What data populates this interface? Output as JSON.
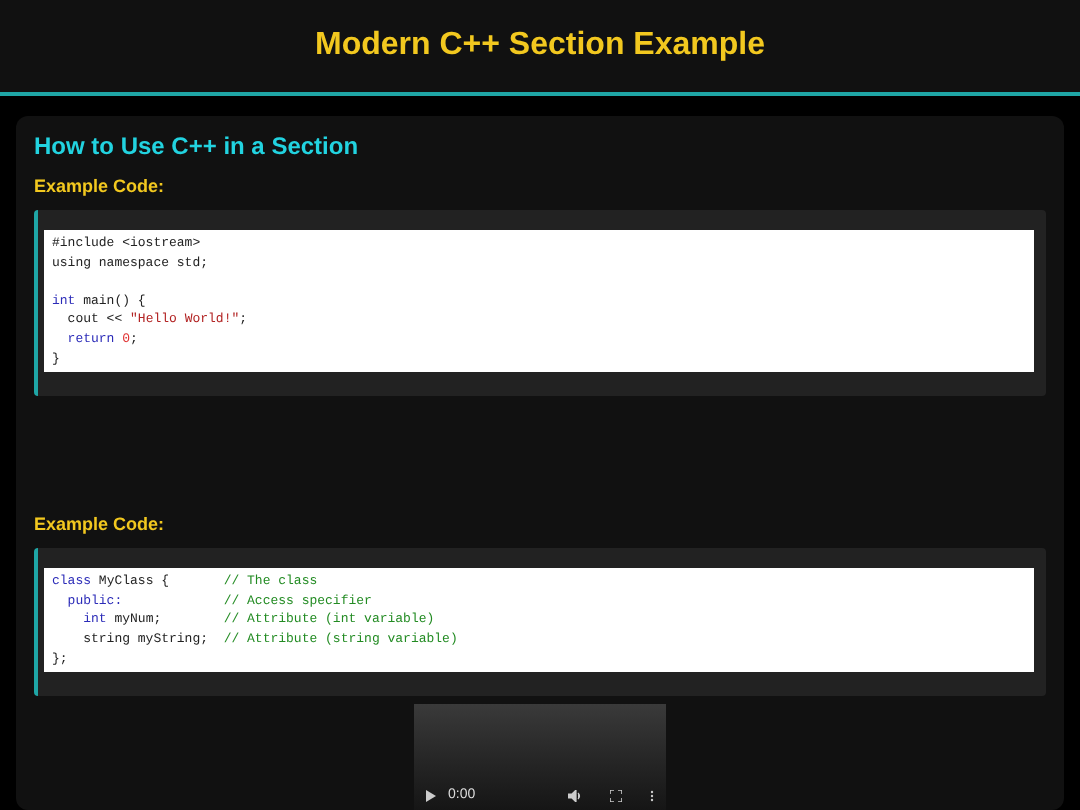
{
  "header": {
    "title": "Modern C++ Section Example"
  },
  "section": {
    "title": "How to Use C++ in a Section",
    "blocks": [
      {
        "label": "Example Code:",
        "lines": [
          {
            "tokens": [
              {
                "kind": "plain",
                "text": "#include <iostream>"
              }
            ]
          },
          {
            "tokens": [
              {
                "kind": "plain",
                "text": "using namespace std;"
              }
            ]
          },
          {
            "blank_before": true,
            "tokens": [
              {
                "kind": "keyword",
                "text": "int"
              },
              {
                "kind": "plain",
                "text": " main() {"
              }
            ]
          },
          {
            "tokens": [
              {
                "kind": "plain",
                "text": "  cout << "
              },
              {
                "kind": "string",
                "text": "\"Hello World!\""
              },
              {
                "kind": "plain",
                "text": ";"
              }
            ]
          },
          {
            "tokens": [
              {
                "kind": "keyword",
                "text": "  return"
              },
              {
                "kind": "number",
                "text": " 0"
              },
              {
                "kind": "plain",
                "text": ";"
              }
            ]
          },
          {
            "tokens": [
              {
                "kind": "plain",
                "text": "}"
              }
            ]
          }
        ]
      },
      {
        "label": "Example Code:",
        "lines": [
          {
            "tokens": [
              {
                "kind": "keyword",
                "text": "class"
              },
              {
                "kind": "plain",
                "text": " MyClass {       "
              },
              {
                "kind": "comment",
                "text": "// The class"
              }
            ]
          },
          {
            "tokens": [
              {
                "kind": "keyword",
                "text": "  public:"
              },
              {
                "kind": "comment",
                "text": "             // Access specifier"
              }
            ]
          },
          {
            "tokens": [
              {
                "kind": "keyword",
                "text": "    int"
              },
              {
                "kind": "plain",
                "text": " myNum;        "
              },
              {
                "kind": "comment",
                "text": "// Attribute (int variable)"
              }
            ]
          },
          {
            "tokens": [
              {
                "kind": "plain",
                "text": "    string myString;  "
              },
              {
                "kind": "comment",
                "text": "// Attribute (string variable)"
              }
            ]
          },
          {
            "tokens": [
              {
                "kind": "plain",
                "text": "};"
              }
            ]
          }
        ]
      }
    ]
  },
  "video": {
    "time": "0:00"
  }
}
